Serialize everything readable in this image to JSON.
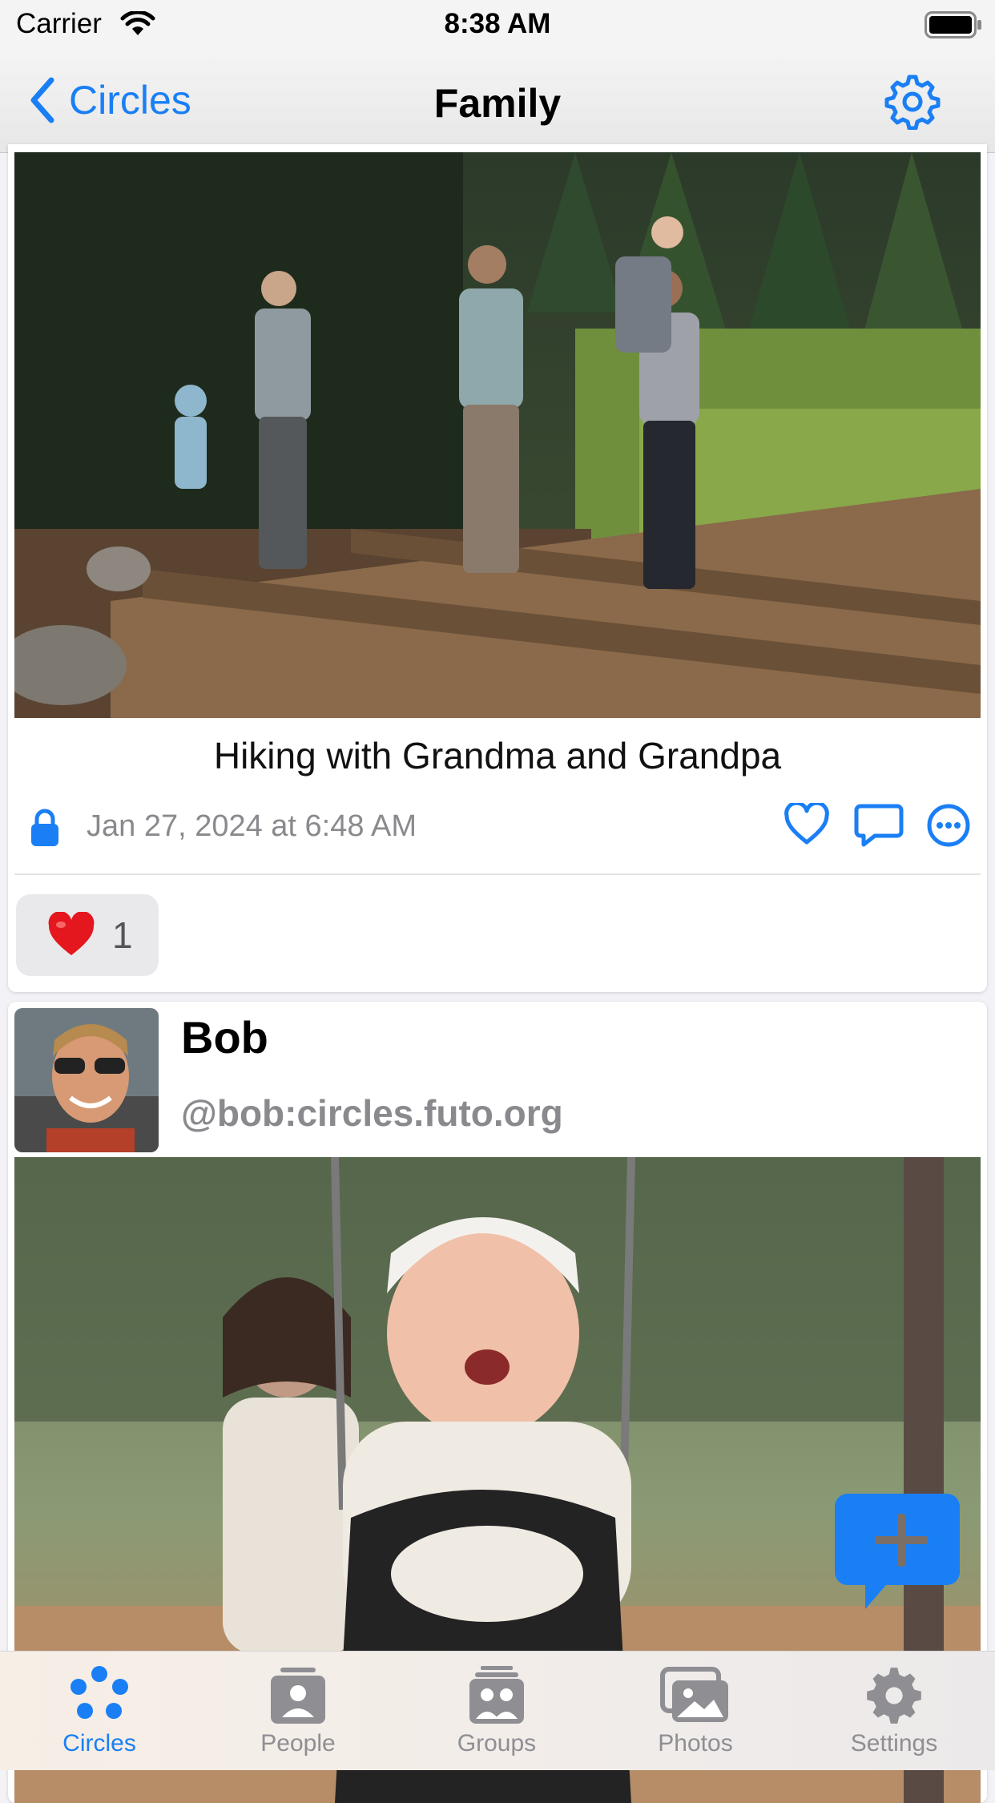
{
  "status_bar": {
    "carrier": "Carrier",
    "time": "8:38 AM"
  },
  "nav": {
    "back_label": "Circles",
    "title": "Family"
  },
  "posts": [
    {
      "caption": "Hiking with Grandma and Grandpa",
      "timestamp": "Jan 27, 2024 at 6:48 AM",
      "reactions": [
        {
          "emoji": "heart",
          "count": "1"
        }
      ]
    },
    {
      "author_name": "Bob",
      "author_handle": "@bob:circles.futo.org"
    }
  ],
  "tabs": [
    {
      "label": "Circles",
      "icon": "circles-icon",
      "active": true
    },
    {
      "label": "People",
      "icon": "person-icon",
      "active": false
    },
    {
      "label": "Groups",
      "icon": "groups-icon",
      "active": false
    },
    {
      "label": "Photos",
      "icon": "photos-icon",
      "active": false
    },
    {
      "label": "Settings",
      "icon": "gear-icon",
      "active": false
    }
  ],
  "colors": {
    "accent": "#1a7ff5"
  }
}
